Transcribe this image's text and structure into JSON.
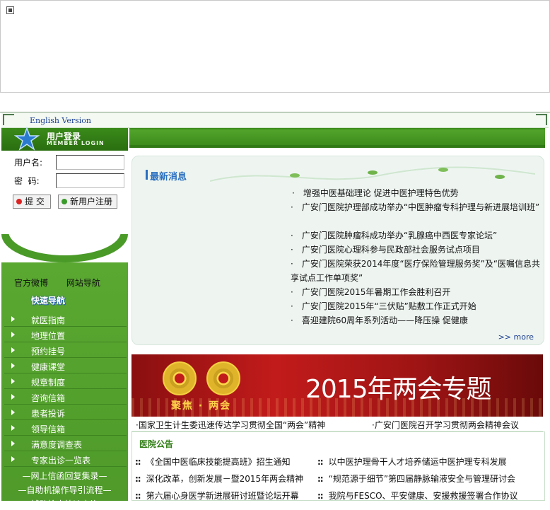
{
  "header": {
    "english": "English Version"
  },
  "login": {
    "title": "用户登录",
    "subtitle": "MEMBER LOGIN",
    "username_label": "用户名:",
    "password_label": "密  码:",
    "username_value": "",
    "password_value": "",
    "submit": "提 交",
    "register": "新用户注册"
  },
  "quick": {
    "weibo": "官方微博",
    "sitemap": "网站导航",
    "title": "快速导航"
  },
  "nav": [
    "就医指南",
    "地理位置",
    "预约挂号",
    "健康课堂",
    "规章制度",
    "咨询信箱",
    "患者投诉",
    "领导信箱",
    "满意度调查表",
    "专家出诊一览表"
  ],
  "sub_links": [
    "—网上信函回复集录—",
    "—自助机操作导引流程—",
    "—  辅助检查快速查询  —"
  ],
  "news": {
    "header": "最新消息",
    "bullet": "·",
    "items": [
      "增强中医基础理论  促进中医护理特色优势",
      "广安门医院护理部成功举办“中医肿瘤专科护理与新进展培训班”",
      "广安门医院肿瘤科成功举办“乳腺癌中西医专家论坛”",
      "广安门医院心理科参与民政部社会服务试点项目",
      "广安门医院荣获2014年度“医疗保险管理服务奖”及“医嘱信息共享试点工作单项奖”",
      "广安门医院2015年暑期工作会胜利召开",
      "广安门医院2015年“三伏贴”贴敷工作正式开始",
      "喜迎建院60周年系列活动——降压操  促健康"
    ],
    "more": ">> more"
  },
  "promo": {
    "title": "2015年两会专题",
    "sub": "聚焦 · 两会",
    "link1": "·国家卫生计生委迅速传达学习贯彻全国“两会”精神",
    "link2": "·广安门医院召开学习贯彻两会精神会议"
  },
  "notices": {
    "title": "医院公告",
    "marker": "::",
    "items": [
      "《全国中医临床技能提高班》招生通知",
      "以中医护理骨干人才培养储运中医护理专科发展",
      "深化改革，创新发展－暨2015年两会精神",
      "“规范源于细节”第四届静脉输液安全与管理研讨会",
      "第六届心身医学新进展研讨班暨论坛开幕",
      "我院与FESCO、平安健康、安援救援签署合作协议"
    ]
  },
  "colors": {
    "green_dark": "#2f7814",
    "green_nav": "#5aa831",
    "news_blue": "#2a6fc0",
    "promo_red": "#c21b1b"
  }
}
